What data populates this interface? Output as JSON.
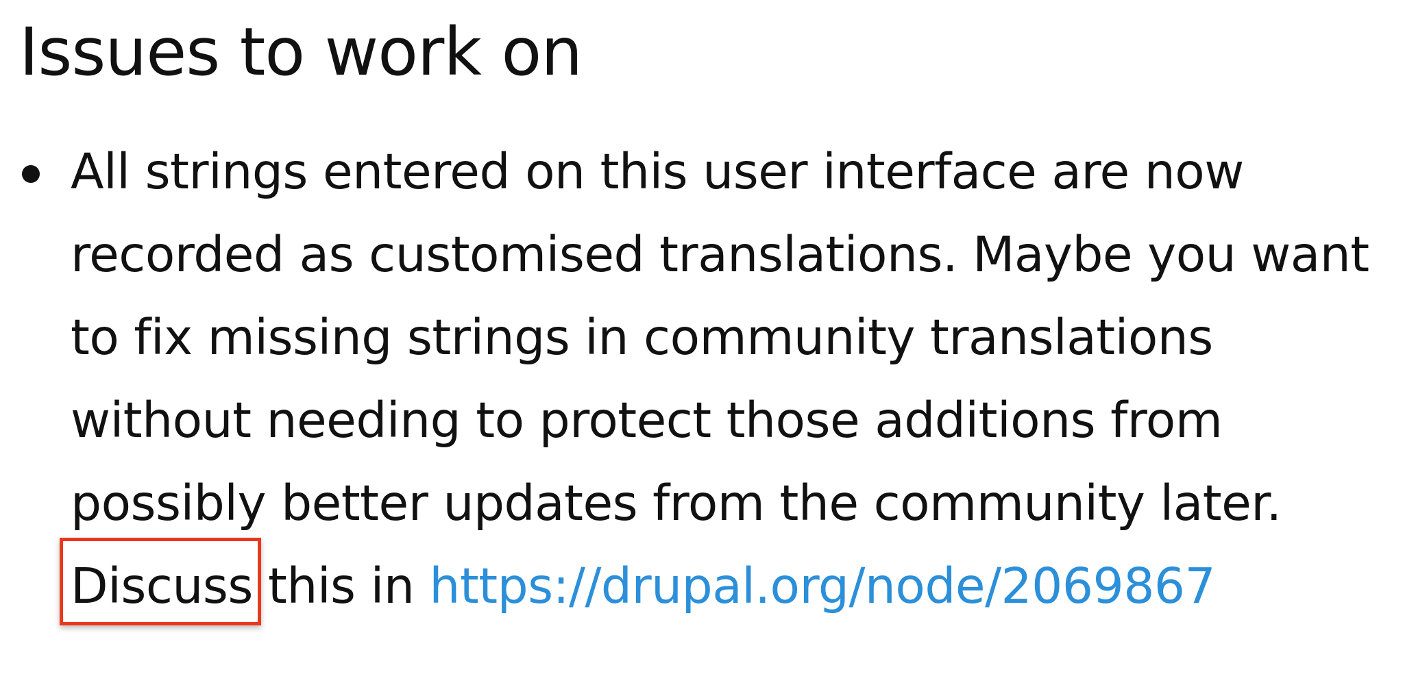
{
  "page_title": "Issues to work on",
  "issues": [
    {
      "lines": [
        "All strings entered on this user interface are now",
        "recorded as customised translations. Maybe you want",
        "to fix missing strings in community translations",
        "without needing to protect those additions from",
        "possibly better updates from the community later."
      ],
      "discuss_word": "Discuss",
      "discuss_suffix": " this in ",
      "link_text": "https://drupal.org/node/2069867"
    }
  ],
  "colors": {
    "text": "#111111",
    "link": "#2b8fd9",
    "highlight": "#e8391f"
  }
}
